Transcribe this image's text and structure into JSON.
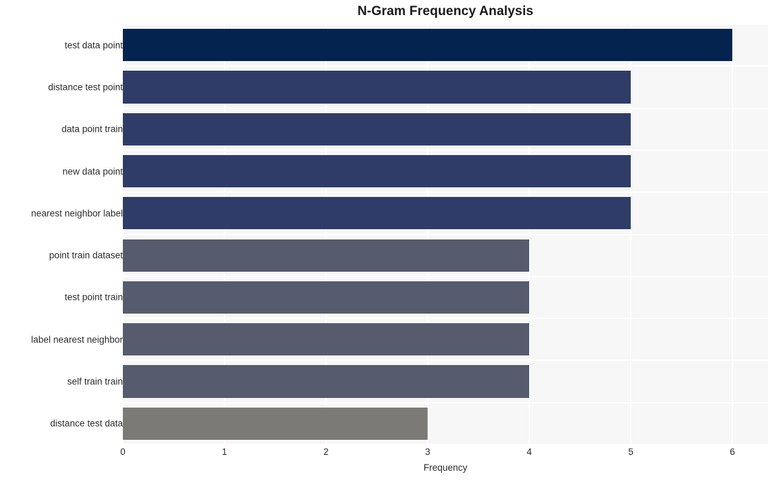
{
  "chart_data": {
    "type": "bar",
    "orientation": "horizontal",
    "title": "N-Gram Frequency Analysis",
    "xlabel": "Frequency",
    "ylabel": "",
    "categories": [
      "test data point",
      "distance test point",
      "data point train",
      "new data point",
      "nearest neighbor label",
      "point train dataset",
      "test point train",
      "label nearest neighbor",
      "self train train",
      "distance test data"
    ],
    "values": [
      6,
      5,
      5,
      5,
      5,
      4,
      4,
      4,
      4,
      3
    ],
    "bar_colors": [
      "#04244f",
      "#2e3c67",
      "#2e3c67",
      "#2e3c67",
      "#2e3c67",
      "#565b6d",
      "#565b6d",
      "#565b6d",
      "#565b6d",
      "#7c7a77"
    ],
    "xlim": [
      0,
      6.35
    ],
    "xticks": [
      0,
      1,
      2,
      3,
      4,
      5,
      6
    ],
    "xticklabels": [
      "0",
      "1",
      "2",
      "3",
      "4",
      "5",
      "6"
    ],
    "grid": true,
    "grid_color": "#ffffff",
    "plot_background": "#f7f7f7",
    "figure_background": "#ffffff",
    "legend": null
  }
}
